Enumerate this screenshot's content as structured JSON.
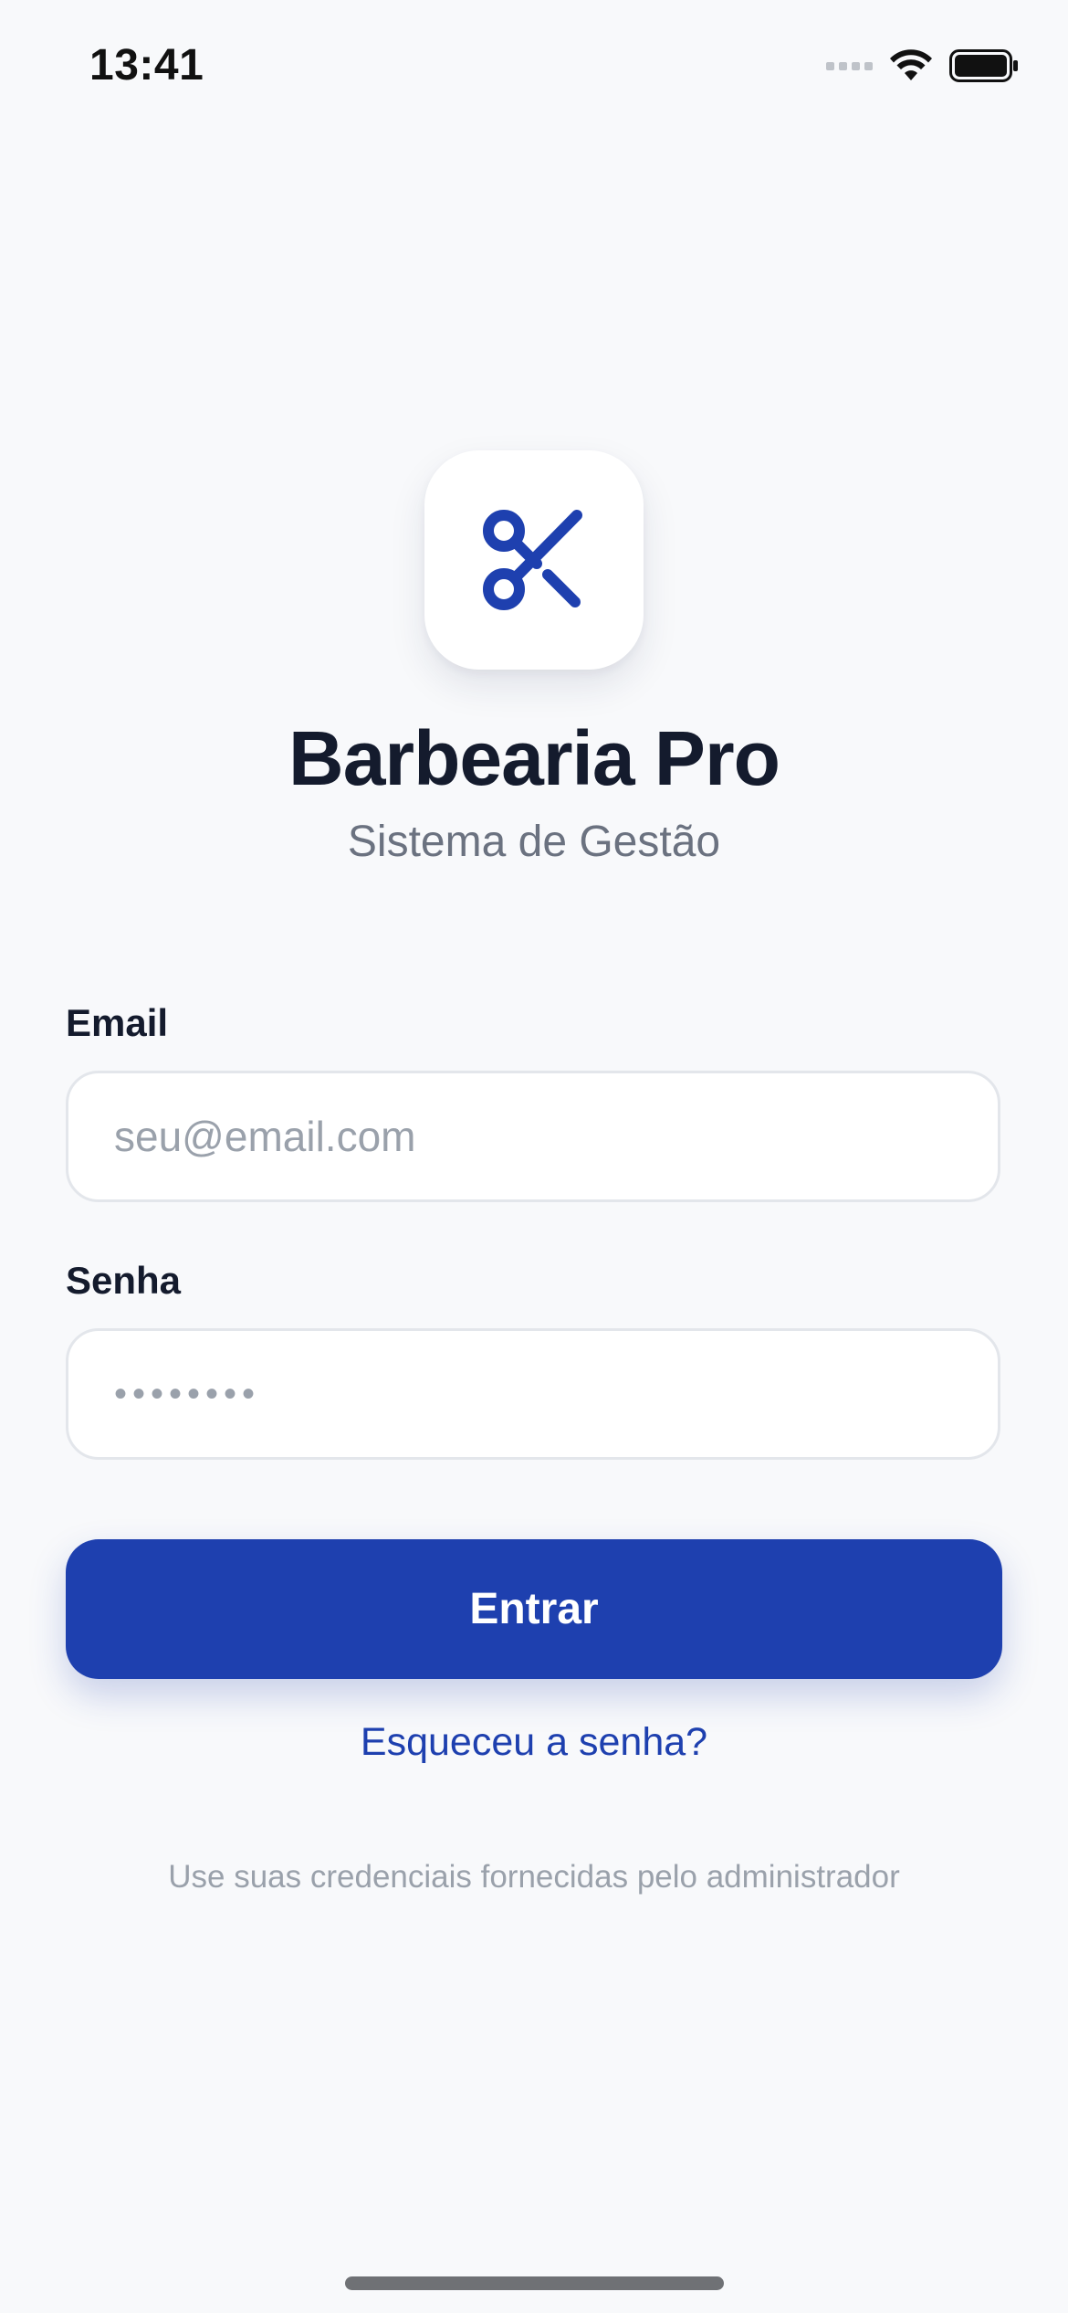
{
  "status_bar": {
    "time": "13:41"
  },
  "app": {
    "logo_icon": "scissors-icon",
    "title": "Barbearia Pro",
    "subtitle": "Sistema de Gestão"
  },
  "form": {
    "email_label": "Email",
    "email_placeholder": "seu@email.com",
    "password_label": "Senha",
    "password_mask": "••••••••",
    "submit_label": "Entrar",
    "forgot_link": "Esqueceu a senha?",
    "helper_text": "Use suas credenciais fornecidas pelo administrador"
  },
  "colors": {
    "primary": "#1e40af",
    "background": "#f8f9fb",
    "title": "#141b2d",
    "muted": "#6b7280",
    "placeholder": "#9aa1ab"
  }
}
